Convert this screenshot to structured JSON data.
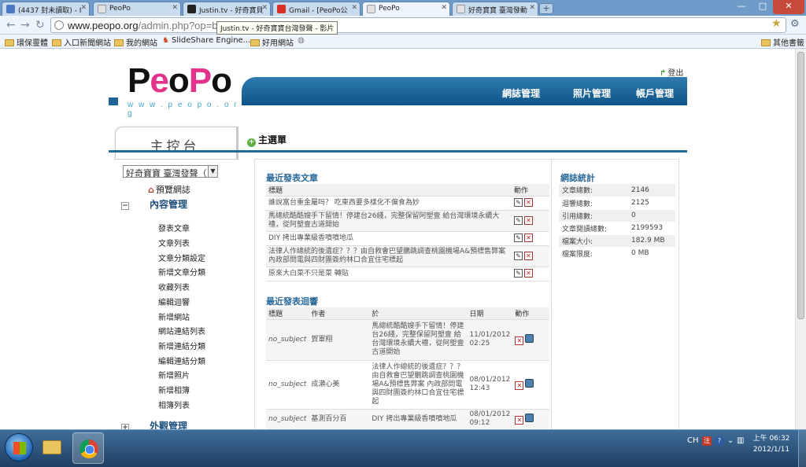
{
  "browser": {
    "tabs": [
      {
        "label": "(4437 封未讀取) - I"
      },
      {
        "label": "PeoPo"
      },
      {
        "label": "Justin.tv - 好奇寶貝"
      },
      {
        "label": "Gmail - [PeoPo公"
      },
      {
        "label": "PeoPo"
      },
      {
        "label": "好奇寶寶 臺灣發動"
      }
    ],
    "new_tab": "+",
    "url_host": "www.peopo.org",
    "url_path": "/admin.php?op=blo",
    "tooltip": "Justin.tv - 好奇寶寶台灣發聲 - 影片",
    "bookmarks": [
      "環保靈體",
      "入口新聞網站",
      "我的網站",
      "SlideShare Engine...",
      "好用網站"
    ],
    "other_bookmarks": "其他書籤"
  },
  "site": {
    "logo": "PeoPo",
    "logo_url": "w w w . p e o p o . o r g",
    "logout": "登出",
    "nav": [
      "網誌管理",
      "照片管理",
      "帳戶管理"
    ]
  },
  "sidebar": {
    "title": "主控台",
    "blog_select": "好奇寶寶 臺灣發聲（",
    "preview": "預覽網誌",
    "content_section": "內容管理",
    "links": [
      "發表文章",
      "文章列表",
      "文章分類設定",
      "新增文章分類",
      "收藏列表",
      "編輯迴響",
      "新增網站",
      "網站連結列表",
      "新增連結分類",
      "編輯連結分類",
      "新增照片",
      "新增相簿",
      "相簿列表"
    ],
    "appearance_section": "外觀管理"
  },
  "main": {
    "menu_label": "主選單",
    "recent_posts": {
      "title": "最近發表文章",
      "col_title": "標題",
      "col_action": "動作",
      "rows": [
        "誰說富台重金屬吗？ 吃東西要多樣化不偏食為妙",
        "馬總統酷酷嫂手下留情！停建台26綫，完整保留阿塱壹 給台灣環境永續大禮，從阿塱壹古道開始",
        "DIY 拷出專業級香噴噴地瓜",
        "法律人作總統的後遺症？？？由自救會巴望鵬跳調查桃園機場A&預標售弊案 內政部問電與四財團簽約林口合宜住宅標起",
        "原來大白菜不只是菜 轉貼"
      ]
    },
    "recent_comments": {
      "title": "最近發表迴響",
      "col_title": "標題",
      "col_author": "作者",
      "col_on": "於",
      "col_date": "日期",
      "col_action": "動作",
      "rows": [
        {
          "title": "no_subject",
          "author": "賀軍翔",
          "on": "馬總統酷酷嫂手下留情！停建台26綫，完整保留阿塱壹 給台灣環境永續大禮，從阿塱壹古道開始",
          "date": "11/01/2012 02:25"
        },
        {
          "title": "no_subject",
          "author": "成瀨心美",
          "on": "法律人作總統的後遺症？？？由自救會巴望鵬跳調查桃園機場A&預標售弊案 內政部問電與四財團簽約林口合宜住宅標起",
          "date": "08/01/2012 12:43"
        },
        {
          "title": "no_subject",
          "author": "基測百分百",
          "on": "DIY 拷出專業級香噴噴地瓜",
          "date": "08/01/2012 09:12"
        }
      ]
    },
    "blog_stats": {
      "title": "網誌統計",
      "rows": [
        {
          "label": "文章總數:",
          "value": "2146"
        },
        {
          "label": "迴響總數:",
          "value": "2125"
        },
        {
          "label": "引用總數:",
          "value": "0"
        },
        {
          "label": "文章閱讀總數:",
          "value": "2199593"
        },
        {
          "label": "檔案大小:",
          "value": "182.9 MB"
        },
        {
          "label": "檔案限度:",
          "value": "0 MB"
        }
      ]
    }
  },
  "taskbar": {
    "lang": "CH",
    "ime": "注",
    "clock_time": "上午 06:32",
    "clock_date": "2012/1/11"
  }
}
